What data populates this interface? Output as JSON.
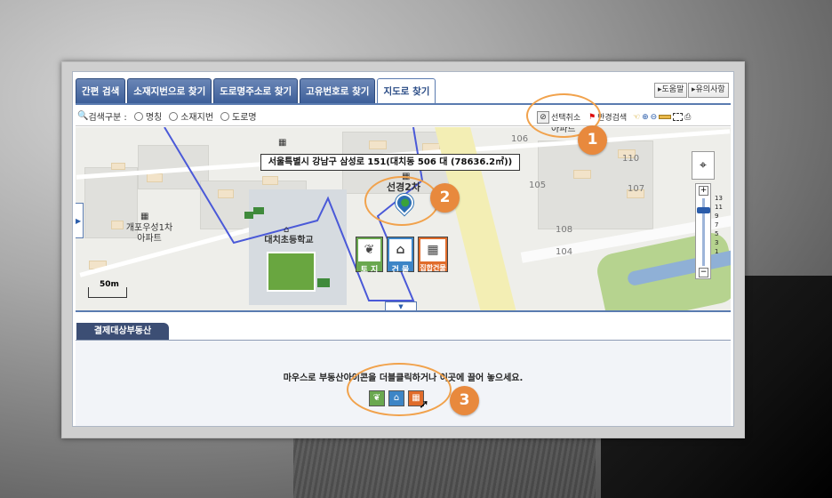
{
  "tabs": [
    {
      "label": "간편 검색"
    },
    {
      "label": "소재지번으로 찾기"
    },
    {
      "label": "도로명주소로 찾기"
    },
    {
      "label": "고유번호로 찾기"
    },
    {
      "label": "지도로 찾기"
    }
  ],
  "help": {
    "guide": "▸도움말",
    "caution": "▸유의사항"
  },
  "search": {
    "label": "검색구분 :",
    "options": [
      "명칭",
      "소재지번",
      "도로명"
    ]
  },
  "toolbar": {
    "deselect": "선택취소",
    "radius_search": "반경검색"
  },
  "map": {
    "address_tooltip": "서울특별시 강남구 삼성로 151(대치동 506 대 (78636.2㎡))",
    "labels": {
      "apt_top": "아파트",
      "seon_apt": "선경2차",
      "gaepo": "개포우성1차",
      "gaepo_sub": "아파트",
      "school": "대치초등학교",
      "dong106": "106",
      "dong110": "110",
      "dong105": "105",
      "dong107": "107",
      "dong108": "108",
      "dong104": "104"
    },
    "scale": "50m",
    "zoom_levels": [
      "13",
      "11",
      "9",
      "7",
      "5",
      "3",
      "1"
    ],
    "property_buttons": {
      "land": "토 지",
      "building": "건 물",
      "collective": "집합건물"
    }
  },
  "callouts": [
    "1",
    "2",
    "3"
  ],
  "bottom": {
    "tab": "결제대상부동산",
    "message": "마우스로 부동산아이콘을 더블클릭하거나 이곳에 끌어 놓으세요."
  },
  "colors": {
    "tab_blue": "#3d5f99",
    "callout_orange": "#e8893d",
    "land_green": "#6aa84f",
    "building_blue": "#3d85c6",
    "collective_orange": "#e06c2b"
  }
}
